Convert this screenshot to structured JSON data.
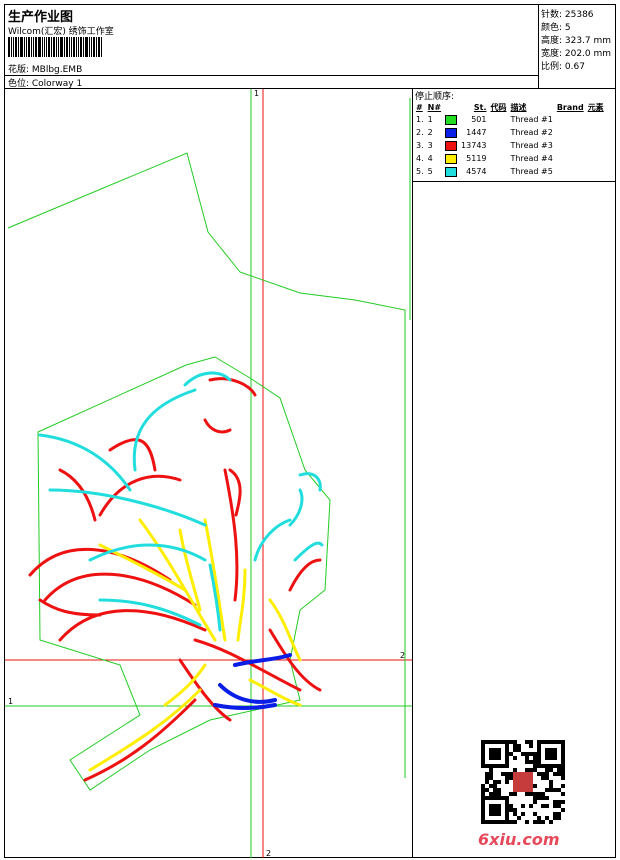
{
  "header": {
    "title": "生产作业图",
    "company": "Wilcom(汇宏) 绣饰工作室"
  },
  "design": {
    "file_label": "花版: MBlbg.EMB",
    "colorway_label": "色位: Colorway 1"
  },
  "stats": [
    {
      "label": "针数: 25386"
    },
    {
      "label": "颜色: 5"
    },
    {
      "label": "高度: 323.7 mm"
    },
    {
      "label": "宽度: 202.0 mm"
    },
    {
      "label": "比例: 0.67"
    }
  ],
  "sequence": {
    "title": "停止顺序:",
    "headers": [
      "#",
      "N#",
      "St.",
      "代码",
      "描述",
      "Brand",
      "元素"
    ],
    "rows": [
      {
        "idx": "1.",
        "n": "1",
        "color": "#22dd22",
        "st": "501",
        "desc": "Thread #1"
      },
      {
        "idx": "2.",
        "n": "2",
        "color": "#0a1ee6",
        "st": "1447",
        "desc": "Thread #2"
      },
      {
        "idx": "3.",
        "n": "3",
        "color": "#ee1111",
        "st": "13743",
        "desc": "Thread #3"
      },
      {
        "idx": "4.",
        "n": "4",
        "color": "#ffee00",
        "st": "5119",
        "desc": "Thread #4"
      },
      {
        "idx": "5.",
        "n": "5",
        "color": "#22dddd",
        "st": "4574",
        "desc": "Thread #5"
      }
    ]
  },
  "guides": {
    "v1": "1",
    "v2": "2",
    "h1": "1",
    "h2": "2"
  },
  "watermark": {
    "text": "6xiu.com"
  },
  "colors": {
    "outline": "#22cc22",
    "guide_red": "#ee1111",
    "guide_green": "#22cc22"
  }
}
